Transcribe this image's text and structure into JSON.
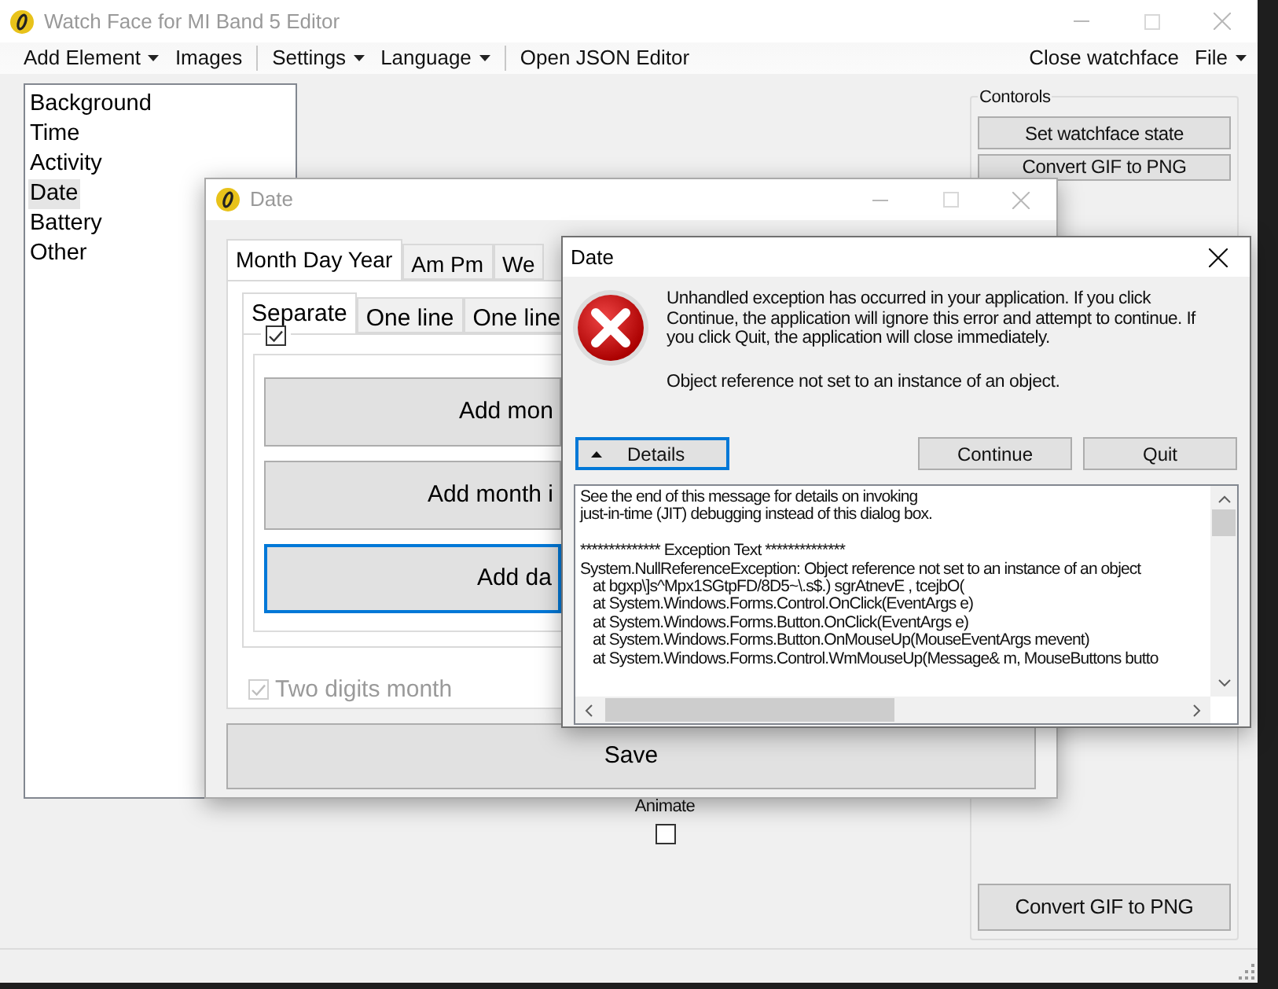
{
  "main_window": {
    "title": "Watch Face for MI Band 5 Editor",
    "menu": [
      {
        "kind": "item",
        "label": "Add Element",
        "dropdown": true
      },
      {
        "kind": "item",
        "label": "Images",
        "dropdown": false
      },
      {
        "kind": "separator"
      },
      {
        "kind": "item",
        "label": "Settings",
        "dropdown": true
      },
      {
        "kind": "item",
        "label": "Language",
        "dropdown": true
      },
      {
        "kind": "separator"
      },
      {
        "kind": "item",
        "label": "Open JSON Editor",
        "dropdown": false
      }
    ],
    "menu_right": [
      {
        "kind": "item",
        "label": "Close watchface",
        "dropdown": false
      },
      {
        "kind": "item",
        "label": "File",
        "dropdown": true
      }
    ],
    "elements_list": [
      {
        "label": "Background",
        "selected": false
      },
      {
        "label": "Time",
        "selected": false
      },
      {
        "label": "Activity",
        "selected": false
      },
      {
        "label": "Date",
        "selected": true
      },
      {
        "label": "Battery",
        "selected": false
      },
      {
        "label": "Other",
        "selected": false
      }
    ],
    "controls_group": {
      "title": "Contorols",
      "buttons": [
        "Set watchface state",
        "Convert GIF to PNG"
      ],
      "bottom_button": "Convert GIF to PNG"
    },
    "animate": {
      "label": "Animate",
      "checked": false
    }
  },
  "date_window": {
    "title": "Date",
    "tabs": [
      {
        "label": "Month Day Year",
        "selected": true
      },
      {
        "label": "Am Pm",
        "selected": false
      },
      {
        "label": "We",
        "selected": false
      }
    ],
    "subtabs": [
      {
        "label": "Separate",
        "selected": true
      },
      {
        "label": "One line",
        "selected": false
      },
      {
        "label": "One line",
        "selected": false
      }
    ],
    "group_checkbox": {
      "checked": true
    },
    "buttons": [
      {
        "label": "Add mon",
        "focused": false
      },
      {
        "label": "Add month i",
        "focused": false
      },
      {
        "label": "Add da",
        "focused": true
      }
    ],
    "two_digits_month": {
      "label": "Two digits month",
      "checked": true,
      "disabled": true
    },
    "save_button": "Save"
  },
  "error_dialog": {
    "title": "Date",
    "message": "Unhandled exception has occurred in your application. If you click Continue, the application will ignore this error and attempt to continue. If you click Quit, the application will close immediately.",
    "error_text": "Object reference not set to an instance of an object.",
    "details_button": {
      "label": "Details",
      "focused": true
    },
    "buttons": [
      "Continue",
      "Quit"
    ],
    "details": [
      {
        "kind": "line",
        "text": "See the end of this message for details on invoking"
      },
      {
        "kind": "line",
        "text": "just-in-time (JIT) debugging instead of this dialog box."
      },
      {
        "kind": "heading",
        "text": "************** Exception Text **************"
      },
      {
        "kind": "line",
        "text": "System.NullReferenceException: Object reference not set to an instance of an object"
      },
      {
        "kind": "frame",
        "text": "at bgxp\\]s^Mpx1SGtpFD/8D5~\\.s$.) sgrAtnevE , tcejbO("
      },
      {
        "kind": "frame",
        "text": "at System.Windows.Forms.Control.OnClick(EventArgs e)"
      },
      {
        "kind": "frame",
        "text": "at System.Windows.Forms.Button.OnClick(EventArgs e)"
      },
      {
        "kind": "frame",
        "text": "at System.Windows.Forms.Button.OnMouseUp(MouseEventArgs mevent)"
      },
      {
        "kind": "frame",
        "text": "at System.Windows.Forms.Control.WmMouseUp(Message& m, MouseButtons butto"
      }
    ]
  }
}
